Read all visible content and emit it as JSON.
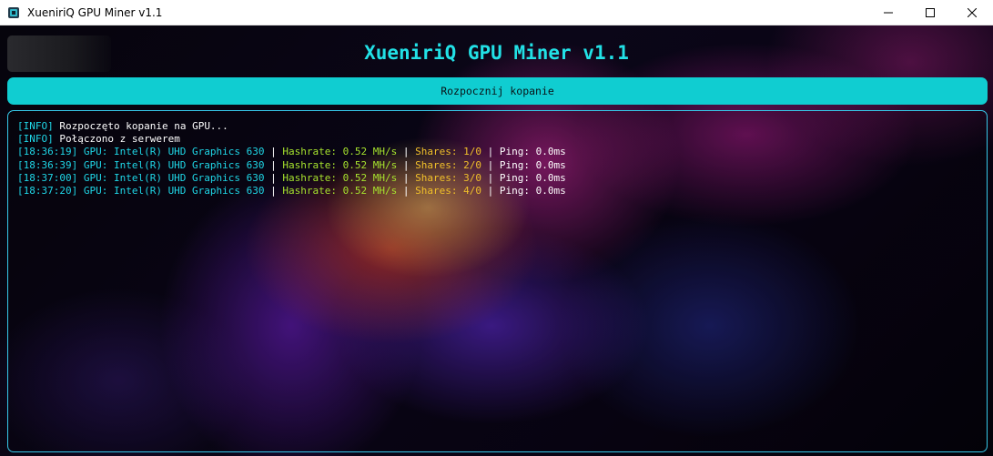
{
  "window": {
    "title": "XueniriQ GPU Miner v1.1",
    "controls": [
      "minimize",
      "maximize",
      "close"
    ]
  },
  "header": {
    "title": "XueniriQ GPU Miner v1.1"
  },
  "actions": {
    "start_label": "Rozpocznij kopanie"
  },
  "console": {
    "info_lines": [
      {
        "tag": "[INFO]",
        "message": " Rozpoczęto kopanie na GPU..."
      },
      {
        "tag": "[INFO]",
        "message": " Połączono z serwerem"
      }
    ],
    "sep": " | ",
    "stat_lines": [
      {
        "prefix": "[18:36:19] GPU: Intel(R) UHD Graphics 630",
        "hashrate": "Hashrate: 0.52 MH/s",
        "shares": "Shares: 1/0",
        "ping": "Ping: 0.0ms"
      },
      {
        "prefix": "[18:36:39] GPU: Intel(R) UHD Graphics 630",
        "hashrate": "Hashrate: 0.52 MH/s",
        "shares": "Shares: 2/0",
        "ping": "Ping: 0.0ms"
      },
      {
        "prefix": "[18:37:00] GPU: Intel(R) UHD Graphics 630",
        "hashrate": "Hashrate: 0.52 MH/s",
        "shares": "Shares: 3/0",
        "ping": "Ping: 0.0ms"
      },
      {
        "prefix": "[18:37:20] GPU: Intel(R) UHD Graphics 630",
        "hashrate": "Hashrate: 0.52 MH/s",
        "shares": "Shares: 4/0",
        "ping": "Ping: 0.0ms"
      }
    ]
  },
  "colors": {
    "accent": "#22e1e6",
    "button": "#10cdd1",
    "border": "#36c8e8",
    "hashrate": "#a6e22e",
    "shares": "#f0c02a"
  }
}
